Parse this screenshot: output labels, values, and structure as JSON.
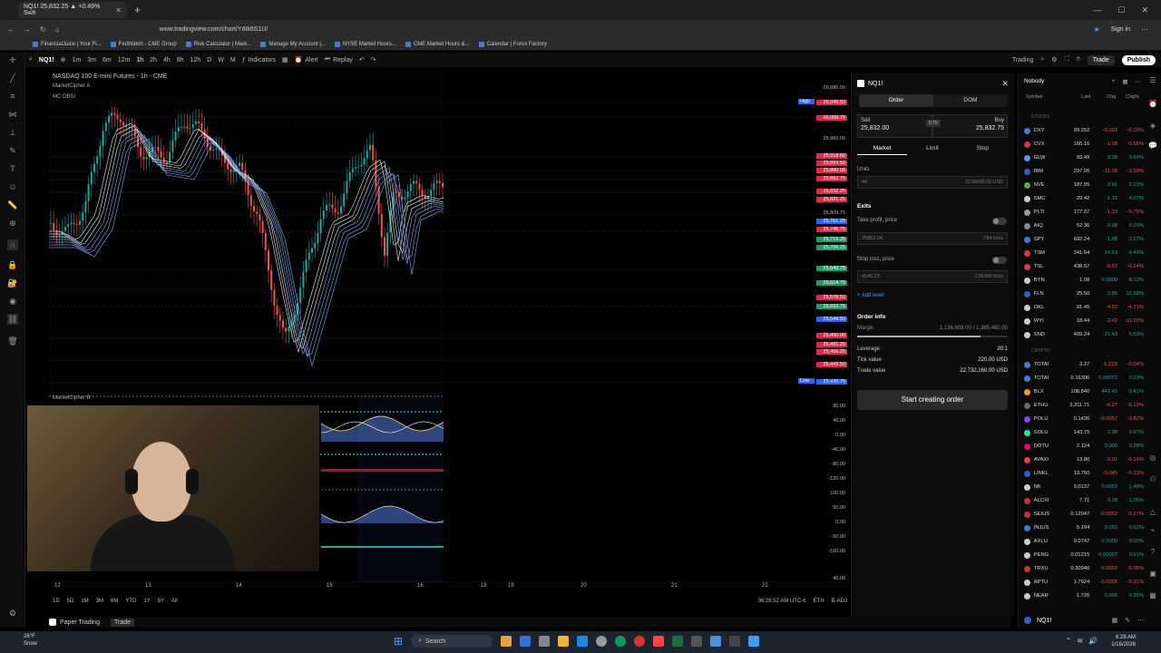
{
  "browser": {
    "tab_title": "NQ1! 25,832.25 ▲ +0.49% Swit",
    "url": "www.tradingview.com/chart/YdIk6S1U/",
    "signin": "Sign in",
    "bookmarks": [
      "FinancialJuice | Your Fi...",
      "FedWatch - CME Group",
      "Risk Calculator | Mark...",
      "Manage My Account |...",
      "NYSE Market Hours...",
      "CME Market Hours &...",
      "Calendar | Forex Factory"
    ]
  },
  "toolbar": {
    "symbol": "NQ1!",
    "intervals": [
      "1m",
      "3m",
      "6m",
      "12m",
      "1h",
      "2h",
      "4h",
      "8h",
      "12h",
      "D",
      "W",
      "M"
    ],
    "indicators": "Indicators",
    "alert": "Alert",
    "replay": "Replay",
    "trading": "Trading",
    "trade": "Trade",
    "publish": "Publish"
  },
  "chart": {
    "title": "NASDAQ 100 E-mini Futures - 1h - CME",
    "indicator1": "MarketCipher A",
    "indicator1b": "MC DBSI",
    "indicator2": "MarketCipher B",
    "high_tag": "High",
    "low_tag": "Low",
    "prices": [
      "26,080.00",
      "26,045.50",
      "26,008.75",
      "25,960.00",
      "25,918.50",
      "25,894.50",
      "25,880.00",
      "25,862.75",
      "25,832.25",
      "25,821.25",
      "25,809.75",
      "25,761.25",
      "25,745.75",
      "25,719.25",
      "25,706.25",
      "25,649.75",
      "25,614.75",
      "25,578.50",
      "25,563.75",
      "25,544.50",
      "25,490.00",
      "25,481.25",
      "25,466.25",
      "25,442.50",
      "25,420.75"
    ],
    "osc_scale": [
      "80.00",
      "40.00",
      "0.00",
      "-40.00",
      "-80.00",
      "-120.00",
      "100.00",
      "50.00",
      "0.00",
      "-50.00",
      "-100.00",
      "40.00"
    ],
    "time_labels": [
      "12",
      "13",
      "14",
      "15",
      "16",
      "18",
      "19",
      "20",
      "21",
      "22"
    ],
    "ranges": [
      "1D",
      "5D",
      "1M",
      "3M",
      "6M",
      "YTD",
      "1Y",
      "5Y",
      "All"
    ],
    "clock": "06:28:52 AM UTC-6",
    "session": "ETH",
    "adj": "B-ADJ",
    "chart_data": {
      "type": "line",
      "title": "NASDAQ 100 E-mini Futures - 1h - CME",
      "x": [
        "12",
        "13",
        "14",
        "15",
        "16"
      ],
      "series": [
        {
          "values": [
            25900,
            26070,
            25620,
            25830,
            25832
          ]
        }
      ],
      "ylim": [
        25400,
        26100
      ]
    }
  },
  "footer": {
    "paper_trading": "Paper Trading",
    "trade": "Trade"
  },
  "order": {
    "symbol": "NQ1!",
    "tab_order": "Order",
    "tab_dom": "DOM",
    "sell_label": "Sell",
    "sell_price": "25,832.00",
    "buy_label": "Buy",
    "buy_price": "25,832.75",
    "spread": "0.75",
    "market": "Market",
    "limit": "Limit",
    "stop": "Stop",
    "units_label": "Units",
    "units_value": "44",
    "units_usd": "1136608.00 USD",
    "exits": "Exits",
    "take_profit": "Take profit, price",
    "tp_value": "25952.04",
    "tp_ticks": "-794 ticks",
    "stop_loss": "Stop loss, price",
    "sl_value": "4546.23",
    "sl_ticks": "-136399 ticks",
    "add_level": "+ Add level",
    "order_info": "Order info",
    "margin": "Margin",
    "margin_value": "1,136,608.00 / 1,385,480.00",
    "leverage": "Leverage",
    "leverage_value": "20:1",
    "tick_value": "Tick value",
    "tick_value_v": "220.00 USD",
    "trade_value": "Trade value",
    "trade_value_v": "22,732,160.00 USD",
    "start": "Start creating order"
  },
  "watchlist": {
    "name": "Nobody",
    "cols": [
      "Symbol",
      "Last",
      "Chg",
      "Chg%"
    ],
    "section_stocks": "STOCKS",
    "section_crypto": "CRYPTO",
    "stocks": [
      {
        "s": "DXY",
        "l": "99.252",
        "c": "-0.102",
        "p": "-0.10%",
        "col": "#3f7ad8"
      },
      {
        "s": "CVX",
        "l": "166.16",
        "c": "-1.08",
        "p": "-0.65%",
        "col": "#d33"
      },
      {
        "s": "GLW",
        "l": "93.49",
        "c": "3.28",
        "p": "3.64%",
        "col": "#4aa0e0"
      },
      {
        "s": "IBM",
        "l": "297.95",
        "c": "-11.08",
        "p": "-3.59%",
        "col": "#2a62c8"
      },
      {
        "s": "NVE",
        "l": "187.05",
        "c": "3.91",
        "p": "2.13%",
        "col": "#4caf50"
      },
      {
        "s": "SMC",
        "l": "29.42",
        "c": "1.15",
        "p": "4.07%",
        "col": "#ccc"
      },
      {
        "s": "PLTI",
        "l": "177.07",
        "c": "-1.33",
        "p": "-0.75%",
        "col": "#999"
      },
      {
        "s": "AIQ",
        "l": "52.36",
        "c": "0.08",
        "p": "0.15%",
        "col": "#888"
      },
      {
        "s": "SPY",
        "l": "692.24",
        "c": "1.88",
        "p": "0.27%",
        "col": "#3f7ad8"
      },
      {
        "s": "TSM",
        "l": "341.64",
        "c": "14.53",
        "p": "4.44%",
        "col": "#d33"
      },
      {
        "s": "TSL",
        "l": "438.57",
        "c": "-0.63",
        "p": "-0.14%",
        "col": "#e53935"
      },
      {
        "s": "BYN",
        "l": "1.08",
        "c": "0.0800",
        "p": "8.12%",
        "col": "#ccc"
      },
      {
        "s": "FLN",
        "l": "25.50",
        "c": "2.85",
        "p": "12.58%",
        "col": "#2a62c8"
      },
      {
        "s": "OKL",
        "l": "91.45",
        "c": "-4.52",
        "p": "-4.71%",
        "col": "#ccc"
      },
      {
        "s": "WYI",
        "l": "18.44",
        "c": "-2.42",
        "p": "-11.60%",
        "col": "#ccc"
      },
      {
        "s": "SND",
        "l": "409.24",
        "c": "21.43",
        "p": "5.53%",
        "col": "#ccc"
      }
    ],
    "crypto": [
      {
        "s": "TOTAI",
        "l": "3.27",
        "c": "-1.21B",
        "p": "-0.04%",
        "col": "#3f7ad8"
      },
      {
        "s": "TOTAI",
        "l": "0.16306",
        "c": "0.00072",
        "p": "0.23%",
        "col": "#3f7ad8"
      },
      {
        "s": "BLX",
        "l": "108,840",
        "c": "443.45",
        "p": "0.41%",
        "col": "#f7931a"
      },
      {
        "s": "ETHU",
        "l": "3,311.71",
        "c": "-6.27",
        "p": "-0.19%",
        "col": "#666"
      },
      {
        "s": "POLU",
        "l": "0.1436",
        "c": "-0.0057",
        "p": "-3.82%",
        "col": "#8247e5"
      },
      {
        "s": "SOLU",
        "l": "143.75",
        "c": "1.38",
        "p": "0.97%",
        "col": "#14f195"
      },
      {
        "s": "DOTU",
        "l": "2.124",
        "c": "0.006",
        "p": "0.28%",
        "col": "#e6007a"
      },
      {
        "s": "AVAXI",
        "l": "13.80",
        "c": "-0.02",
        "p": "-0.14%",
        "col": "#e84142"
      },
      {
        "s": "LINKL",
        "l": "13.750",
        "c": "-0.045",
        "p": "-0.33%",
        "col": "#2a5ada"
      },
      {
        "s": "NK",
        "l": "0.0137",
        "c": "0.0002",
        "p": "1.48%",
        "col": "#ccc"
      },
      {
        "s": "ALCXI",
        "l": "7.71",
        "c": "0.08",
        "p": "1.05%",
        "col": "#c33"
      },
      {
        "s": "SEIUS",
        "l": "0.12047",
        "c": "-0.0002",
        "p": "-0.17%",
        "col": "#c33"
      },
      {
        "s": "INJUS",
        "l": "5.194",
        "c": "0.032",
        "p": "0.62%",
        "col": "#3f7ad8"
      },
      {
        "s": "AXLU",
        "l": "0.0747",
        "c": "0.0000",
        "p": "0.00%",
        "col": "#ccc"
      },
      {
        "s": "PENG",
        "l": "0.01215",
        "c": "0.00007",
        "p": "0.61%",
        "col": "#ccc"
      },
      {
        "s": "TRXU",
        "l": "0.30940",
        "c": "-0.0002",
        "p": "-0.05%",
        "col": "#c33"
      },
      {
        "s": "APTU",
        "l": "1.7924",
        "c": "-0.0056",
        "p": "-0.31%",
        "col": "#ccc"
      },
      {
        "s": "NEAR",
        "l": "1.726",
        "c": "0.006",
        "p": "0.35%",
        "col": "#ccc"
      }
    ],
    "footer_symbol": "NQ1!"
  },
  "taskbar": {
    "weather_temp": "26°F",
    "weather_desc": "Snow",
    "search": "Search",
    "time": "6:28 AM",
    "date": "1/16/2026"
  }
}
